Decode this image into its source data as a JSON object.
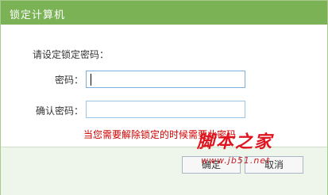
{
  "dialog": {
    "title": "锁定计算机",
    "instruction": "请设定锁定密码：",
    "password_label": "密码：",
    "confirm_label": "确认密码：",
    "password_value": "",
    "confirm_value": "",
    "error_message": "当您需要解除锁定的时候需要此密码",
    "ok_label": "确定",
    "cancel_label": "取消"
  },
  "watermark": {
    "text": "脚本之家",
    "url": "www.jb51.net"
  },
  "colors": {
    "titlebar": "#7ab255",
    "error": "#cc0000",
    "watermark": "#e0141e"
  }
}
